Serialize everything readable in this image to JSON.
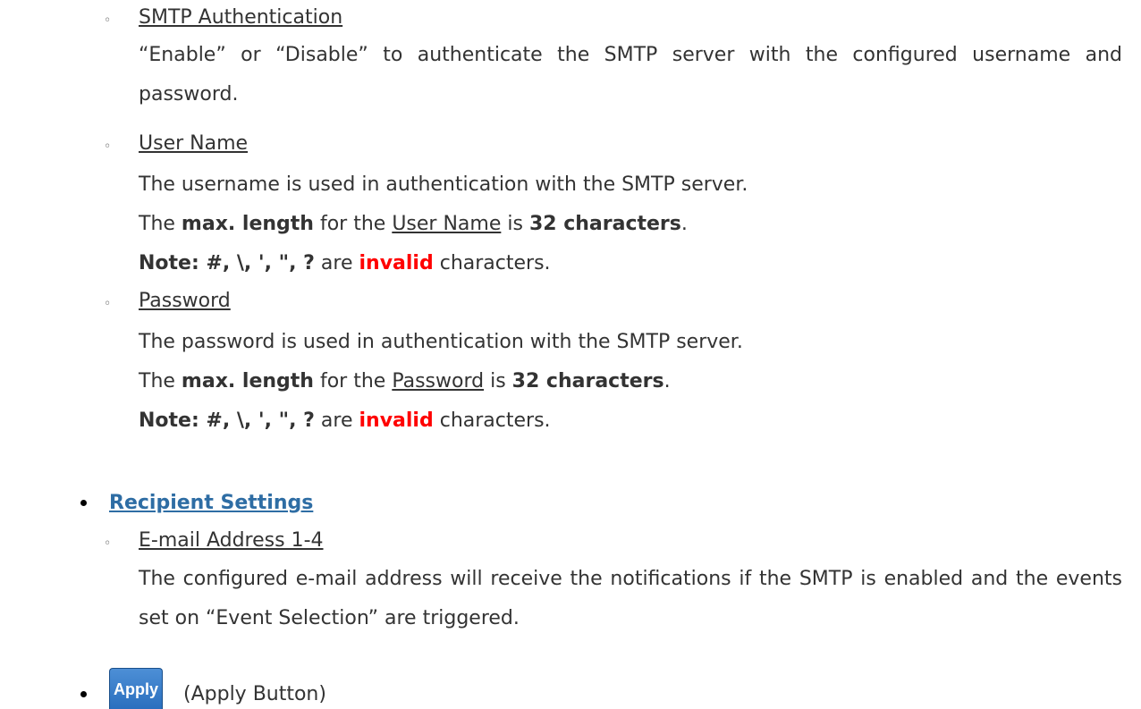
{
  "smtp_auth": {
    "title": "SMTP Authentication",
    "desc": "“Enable” or “Disable” to authenticate the SMTP server with the configured username and password."
  },
  "user_name": {
    "title": "User Name",
    "desc": "The username is used in authentication with the SMTP server.",
    "max_prefix": "The",
    "max_bold": "max. length",
    "max_mid": "for the",
    "max_field": "User Name",
    "max_is": "is",
    "max_value": "32 characters",
    "period": ".",
    "note_label": "Note: #, \\, ', \", ?",
    "note_are": "are",
    "note_invalid": "invalid",
    "note_suffix": "characters."
  },
  "password": {
    "title": "Password",
    "desc": "The password is used in authentication with the SMTP server.",
    "max_prefix": "The",
    "max_bold": "max. length",
    "max_mid": "for the",
    "max_field": "Password",
    "max_is": "is",
    "max_value": "32 characters",
    "period": ".",
    "note_label": "Note: #, \\, ', \", ?",
    "note_are": "are",
    "note_invalid": "invalid",
    "note_suffix": "characters."
  },
  "recipient": {
    "heading": "Recipient Settings",
    "email_title": "E-mail Address 1-4",
    "email_desc": "The configured e-mail address will receive the notifications if the SMTP is enabled and the events set on “Event Selection” are triggered."
  },
  "apply": {
    "button_label": "Apply",
    "caption": "(Apply Button)"
  },
  "glyphs": {
    "sub_bullet": "◦"
  }
}
